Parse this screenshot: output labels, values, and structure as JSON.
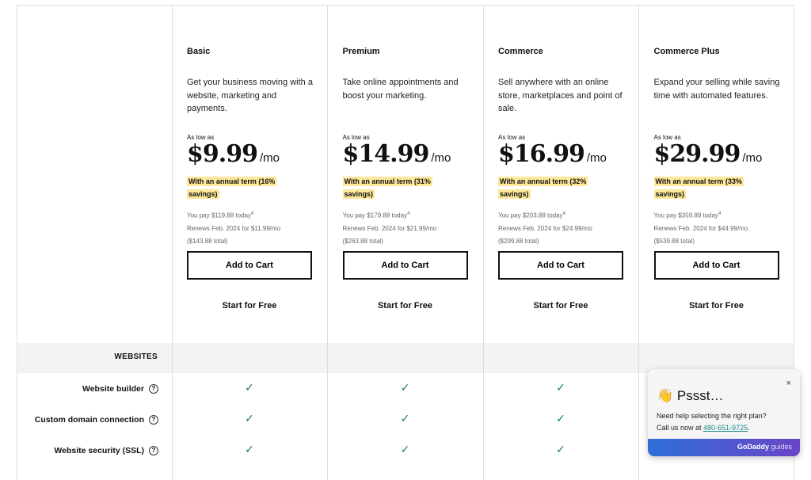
{
  "plans": [
    {
      "name": "Basic",
      "desc": "Get your business moving with a website, marketing and payments.",
      "as_low_as": "As low as",
      "price": "$9.99",
      "per": "/mo",
      "savings": "With an annual term (16% savings)",
      "pay_today": "You pay $119.88 today",
      "footnote": "4",
      "renews": "Renews Feb. 2024 for $11.99/mo",
      "total": "($143.88 total)",
      "cart": "Add to Cart",
      "free": "Start for Free"
    },
    {
      "name": "Premium",
      "desc": "Take online appointments and boost your marketing.",
      "as_low_as": "As low as",
      "price": "$14.99",
      "per": "/mo",
      "savings": "With an annual term (31% savings)",
      "pay_today": "You pay $179.88 today",
      "footnote": "4",
      "renews": "Renews Feb. 2024 for $21.99/mo",
      "total": "($263.88 total)",
      "cart": "Add to Cart",
      "free": "Start for Free"
    },
    {
      "name": "Commerce",
      "desc": "Sell anywhere with an online store, marketplaces and point of sale.",
      "as_low_as": "As low as",
      "price": "$16.99",
      "per": "/mo",
      "savings": "With an annual term (32% savings)",
      "pay_today": "You pay $203.88 today",
      "footnote": "4",
      "renews": "Renews Feb. 2024 for $24.99/mo",
      "total": "($299.88 total)",
      "cart": "Add to Cart",
      "free": "Start for Free"
    },
    {
      "name": "Commerce Plus",
      "desc": "Expand your selling while saving time with automated features.",
      "as_low_as": "As low as",
      "price": "$29.99",
      "per": "/mo",
      "savings": "With an annual term (33% savings)",
      "pay_today": "You pay $359.88 today",
      "footnote": "4",
      "renews": "Renews Feb. 2024 for $44.99/mo",
      "total": "($539.88 total)",
      "cart": "Add to Cart",
      "free": "Start for Free"
    }
  ],
  "section": "WEBSITES",
  "features": [
    {
      "label": "Website builder",
      "included": [
        true,
        true,
        true,
        true
      ]
    },
    {
      "label": "Custom domain connection",
      "included": [
        true,
        true,
        true,
        true
      ]
    },
    {
      "label": "Website security (SSL)",
      "included": [
        true,
        true,
        true,
        true
      ]
    }
  ],
  "help_glyph": "?",
  "check_glyph": "✓",
  "chat": {
    "close": "×",
    "emoji": "👋",
    "title": "Pssst…",
    "line1": "Need help selecting the right plan?",
    "line2": "Call us now at ",
    "phone": "480-651-9725",
    "period": ".",
    "brand": "GoDaddy",
    "brand_suffix": " guides"
  },
  "colors": {
    "highlight": "#fde89a",
    "check": "#1c7b7b",
    "band": "#f3f3f3"
  }
}
